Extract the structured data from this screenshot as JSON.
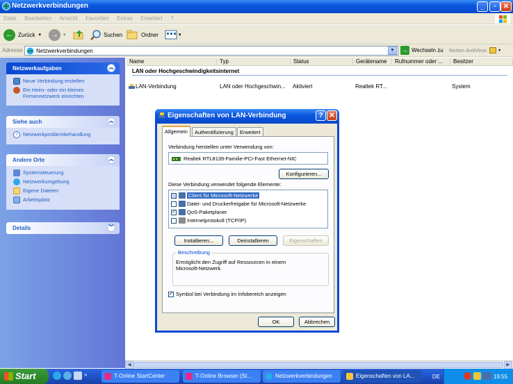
{
  "window": {
    "title": "Netzwerkverbindungen",
    "menu": [
      "Datei",
      "Bearbeiten",
      "Ansicht",
      "Favoriten",
      "Extras",
      "Erweitert",
      "?"
    ]
  },
  "toolbar": {
    "back_label": "Zurück",
    "search_label": "Suchen",
    "folders_label": "Ordner"
  },
  "address": {
    "label": "Adresse",
    "value": "Netzwerkverbindungen",
    "go_label": "Wechseln zu",
    "norton_label": "Norton AntiVirus"
  },
  "sidebar": {
    "panels": [
      {
        "title": "Netzwerkaufgaben",
        "items": [
          "Neue Verbindung erstellen",
          "Ein Heim- oder ein kleines Firmennetzwerk einrichten"
        ]
      },
      {
        "title": "Siehe auch",
        "items": [
          "Netzwerkproblembehandlung"
        ]
      },
      {
        "title": "Andere Orte",
        "items": [
          "Systemsteuerung",
          "Netzwerkumgebung",
          "Eigene Dateien",
          "Arbeitsplatz"
        ]
      },
      {
        "title": "Details",
        "items": []
      }
    ]
  },
  "list": {
    "columns": [
      "Name",
      "Typ",
      "Status",
      "Gerätename",
      "Rufnummer oder ...",
      "Besitzer"
    ],
    "group": "LAN oder Hochgeschwindigkeitsinternet",
    "rows": [
      {
        "name": "LAN-Verbindung",
        "type": "LAN oder Hochgeschwin...",
        "status": "Aktiviert",
        "device": "Realtek RT...",
        "phone": "",
        "owner": "System"
      }
    ]
  },
  "dialog": {
    "title": "Eigenschaften von LAN-Verbindung",
    "tabs": [
      "Allgemein",
      "Authentifizierung",
      "Erweitert"
    ],
    "connect_using_label": "Verbindung herstellen unter Verwendung von:",
    "adapter": "Realtek RTL8139-Familie-PCI-Fast Ethernet-NIC",
    "configure_button": "Konfigurieren...",
    "components_label": "Diese Verbindung verwendet folgende Elemente:",
    "components": [
      {
        "label": "Client für Microsoft-Netzwerke",
        "checked": true,
        "selected": true
      },
      {
        "label": "Datei- und Druckerfreigabe für Microsoft-Netzwerke",
        "checked": false,
        "selected": false
      },
      {
        "label": "QoS-Paketplaner",
        "checked": true,
        "selected": false
      },
      {
        "label": "Internetprotokoll (TCP/IP)",
        "checked": false,
        "selected": false
      }
    ],
    "install_button": "Installieren...",
    "uninstall_button": "Deinstallieren",
    "properties_button": "Eigenschaften",
    "description_legend": "Beschreibung",
    "description_text": "Ermöglicht den Zugriff auf Ressourcen in einem Microsoft-Netzwerk.",
    "tray_icon_label": "Symbol bei Verbindung im Infobereich anzeigen",
    "tray_icon_checked": true,
    "ok_button": "OK",
    "cancel_button": "Abbrechen"
  },
  "taskbar": {
    "start_label": "Start",
    "tasks": [
      "T-Online StartCenter",
      "T-Online Browser (St...",
      "Netzwerkverbindungen",
      "Eigenschaften von LA..."
    ],
    "lang": "DE",
    "clock": "19:55"
  }
}
